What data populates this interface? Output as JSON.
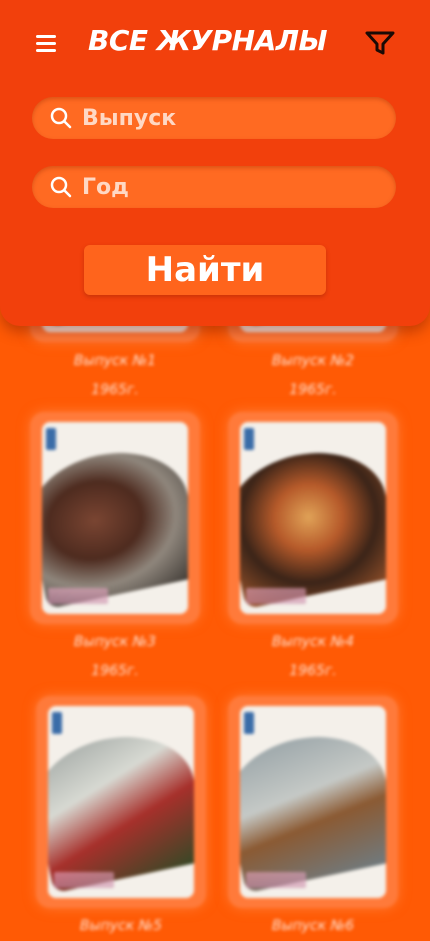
{
  "header": {
    "title": "ВСЕ ЖУРНАЛЫ",
    "search_issue_placeholder": "Выпуск",
    "search_year_placeholder": "Год",
    "find_button": "Найти",
    "icons": {
      "menu": "hamburger-menu-icon",
      "filter": "filter-funnel-icon",
      "search": "search-icon"
    }
  },
  "magazines": [
    {
      "name": "Выпуск №1",
      "year": "1965г."
    },
    {
      "name": "Выпуск №2",
      "year": "1965г."
    },
    {
      "name": "Выпуск №3",
      "year": "1965г."
    },
    {
      "name": "Выпуск №4",
      "year": "1965г."
    },
    {
      "name": "Выпуск №5",
      "year": ""
    },
    {
      "name": "Выпуск №6",
      "year": ""
    }
  ],
  "colors": {
    "header_bg": "#f2400c",
    "page_bg": "#ff5a05",
    "field_bg": "#ff6a22",
    "text": "#ffffff"
  }
}
